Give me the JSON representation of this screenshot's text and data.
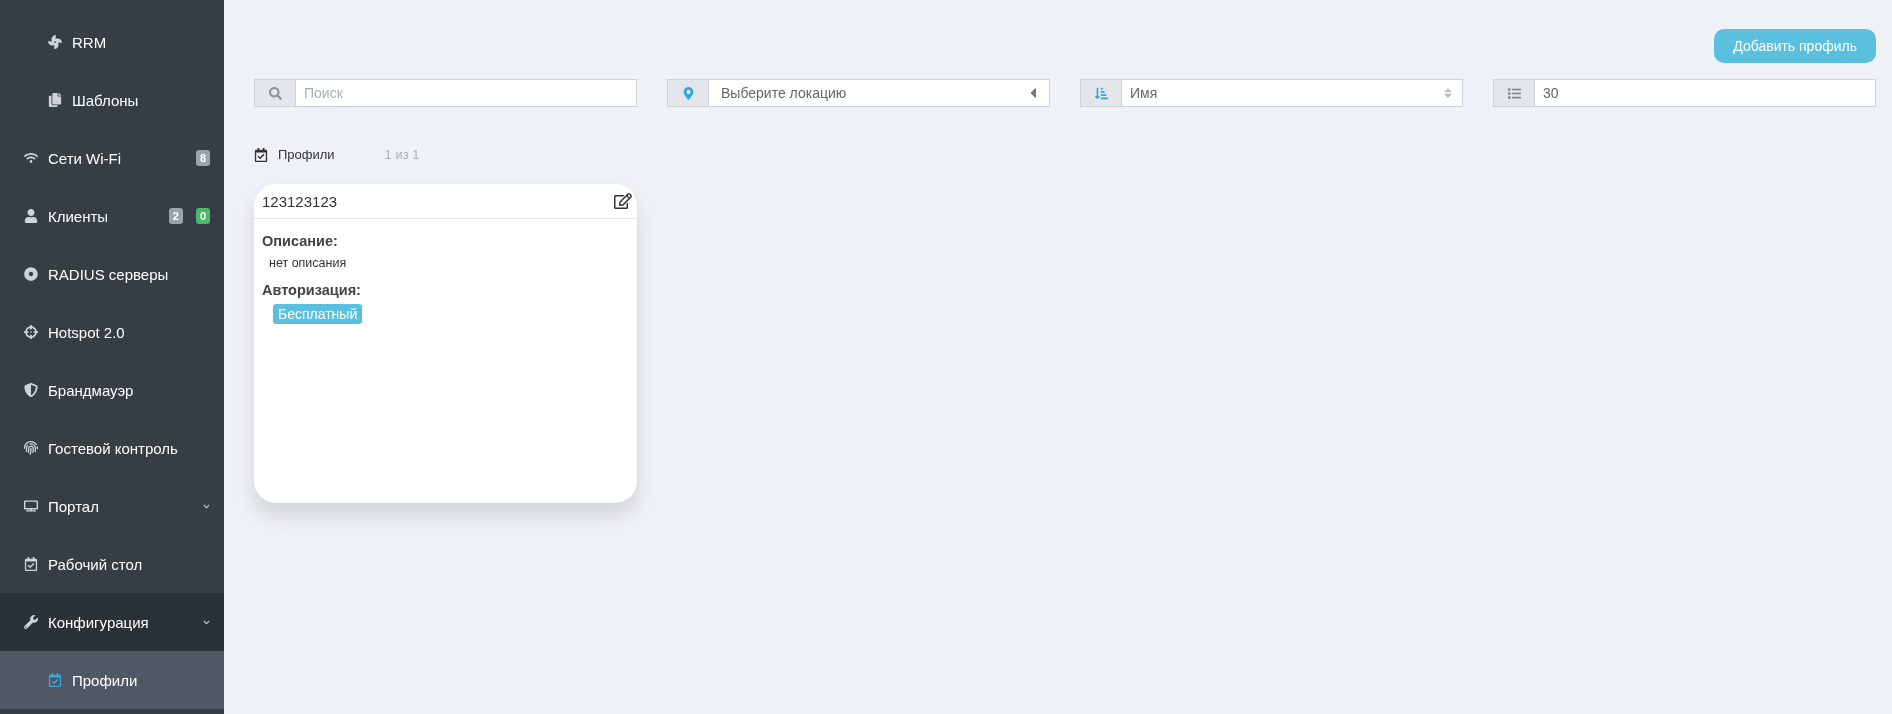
{
  "sidebar": {
    "items": [
      {
        "label": "RRM",
        "kind": "sub",
        "selected": false
      },
      {
        "label": "Шаблоны",
        "kind": "sub",
        "selected": false
      },
      {
        "label": "Сети Wi-Fi",
        "kind": "top",
        "selected": false,
        "badges": [
          {
            "text": "8",
            "color": "#9aa2ab"
          }
        ]
      },
      {
        "label": "Клиенты",
        "kind": "top",
        "selected": false,
        "badges": [
          {
            "text": "2",
            "color": "#9aa2ab"
          },
          {
            "text": "0",
            "color": "#4cb86a"
          }
        ]
      },
      {
        "label": "RADIUS серверы",
        "kind": "top",
        "selected": false
      },
      {
        "label": "Hotspot 2.0",
        "kind": "top",
        "selected": false
      },
      {
        "label": "Брандмауэр",
        "kind": "top",
        "selected": false
      },
      {
        "label": "Гостевой контроль",
        "kind": "top",
        "selected": false
      },
      {
        "label": "Портал",
        "kind": "group",
        "selected": false,
        "expanded": false
      },
      {
        "label": "Рабочий стол",
        "kind": "top",
        "selected": false
      },
      {
        "label": "Конфигурация",
        "kind": "group",
        "selected": false,
        "expanded": true
      },
      {
        "label": "Профили",
        "kind": "sub",
        "selected": true
      }
    ]
  },
  "toolbar": {
    "add_button": "Добавить профиль"
  },
  "filters": {
    "search": {
      "placeholder": "Поиск"
    },
    "location": {
      "value": "Выберите локацию"
    },
    "sort": {
      "value": "Имя"
    },
    "page_size": {
      "value": "30"
    }
  },
  "section": {
    "title": "Профили",
    "count": "1 из 1"
  },
  "profiles": [
    {
      "name": "123123123",
      "description_label": "Описание:",
      "description": "нет описания",
      "auth_label": "Авторизация:",
      "auth_tags": [
        "Бесплатный"
      ]
    }
  ]
}
